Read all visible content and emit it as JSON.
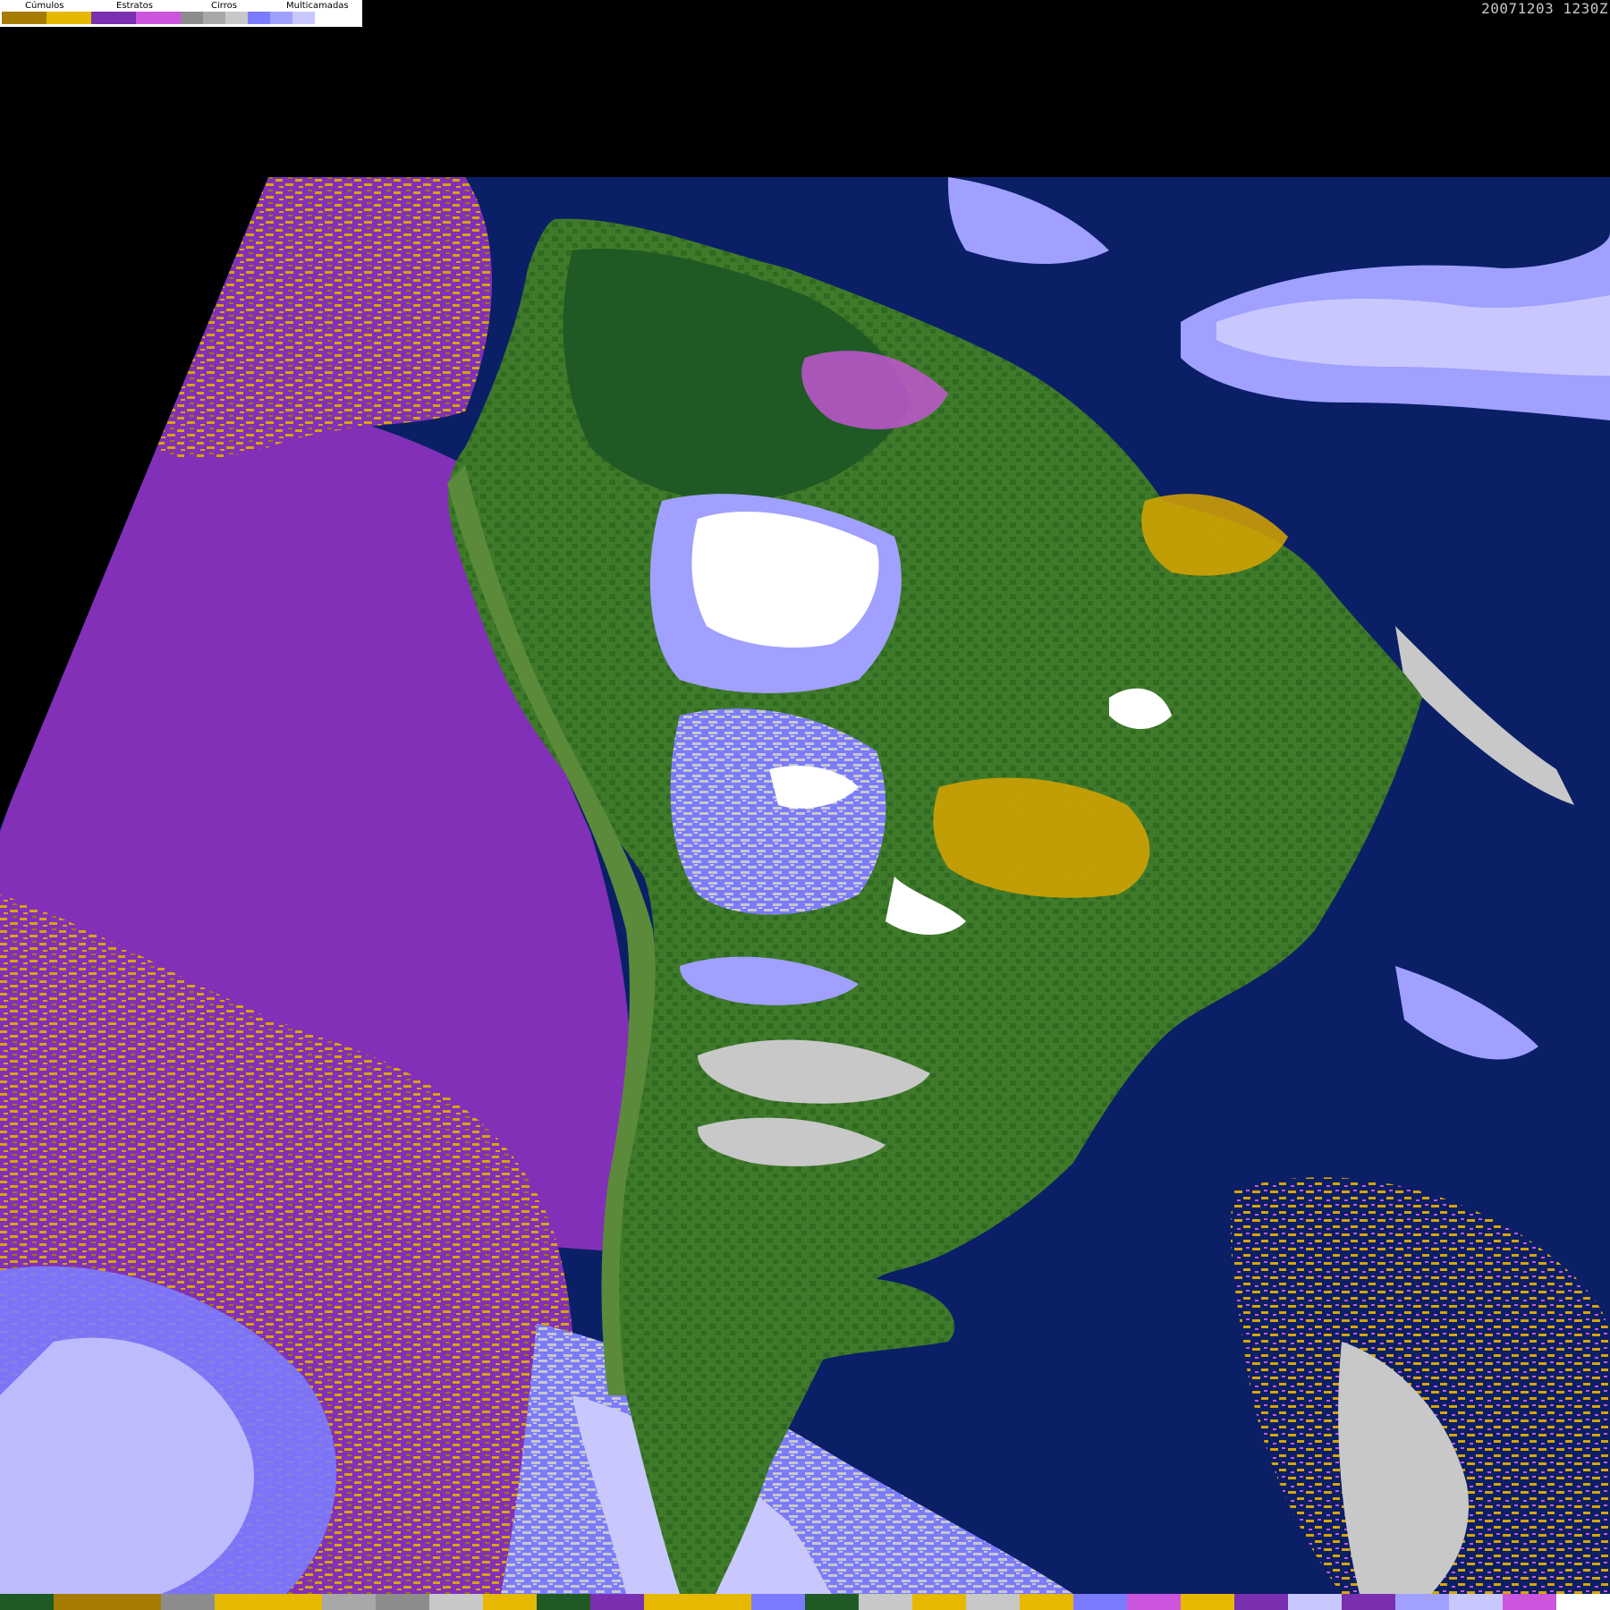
{
  "timestamp": "20071203 1230Z",
  "legend": {
    "groups": [
      {
        "label": "Cúmulos",
        "colors": [
          "#a57c00",
          "#e6b800"
        ]
      },
      {
        "label": "Estratos",
        "colors": [
          "#7a2fb0",
          "#cc55dd"
        ]
      },
      {
        "label": "Cirros",
        "colors": [
          "#8c8c8c",
          "#a8a8a8",
          "#c8c8c8"
        ]
      },
      {
        "label": "Multicamadas",
        "colors": [
          "#7b7bff",
          "#a0a0ff",
          "#c8c8ff",
          "#ffffff"
        ]
      }
    ]
  },
  "palette": {
    "ocean": "#0a1f66",
    "land": "#3f7a2a",
    "land_dark": "#1f5a24",
    "stratus": "#8230b8",
    "cumulus": "#d9a400",
    "cumulus_dark": "#a07a00",
    "multilayer": "#7b7bff",
    "multilayer_light": "#c8c8ff",
    "cirrus": "#b8b8b8",
    "background": "#000000"
  },
  "bottom_strip": {
    "colors": [
      "#1f5a24",
      "#a57c00",
      "#a57c00",
      "#8c8c8c",
      "#e6b800",
      "#e6b800",
      "#a8a8a8",
      "#8c8c8c",
      "#c8c8c8",
      "#e6b800",
      "#1f5a24",
      "#7a2fb0",
      "#e6b800",
      "#e6b800",
      "#7b7bff",
      "#1f5a24",
      "#c8c8c8",
      "#e6b800",
      "#c8c8c8",
      "#e6b800",
      "#7b7bff",
      "#cc55dd",
      "#e6b800",
      "#7a2fb0",
      "#c8c8ff",
      "#7a2fb0",
      "#a0a0ff",
      "#c8c8ff",
      "#cc55dd",
      "#ffffff"
    ]
  }
}
